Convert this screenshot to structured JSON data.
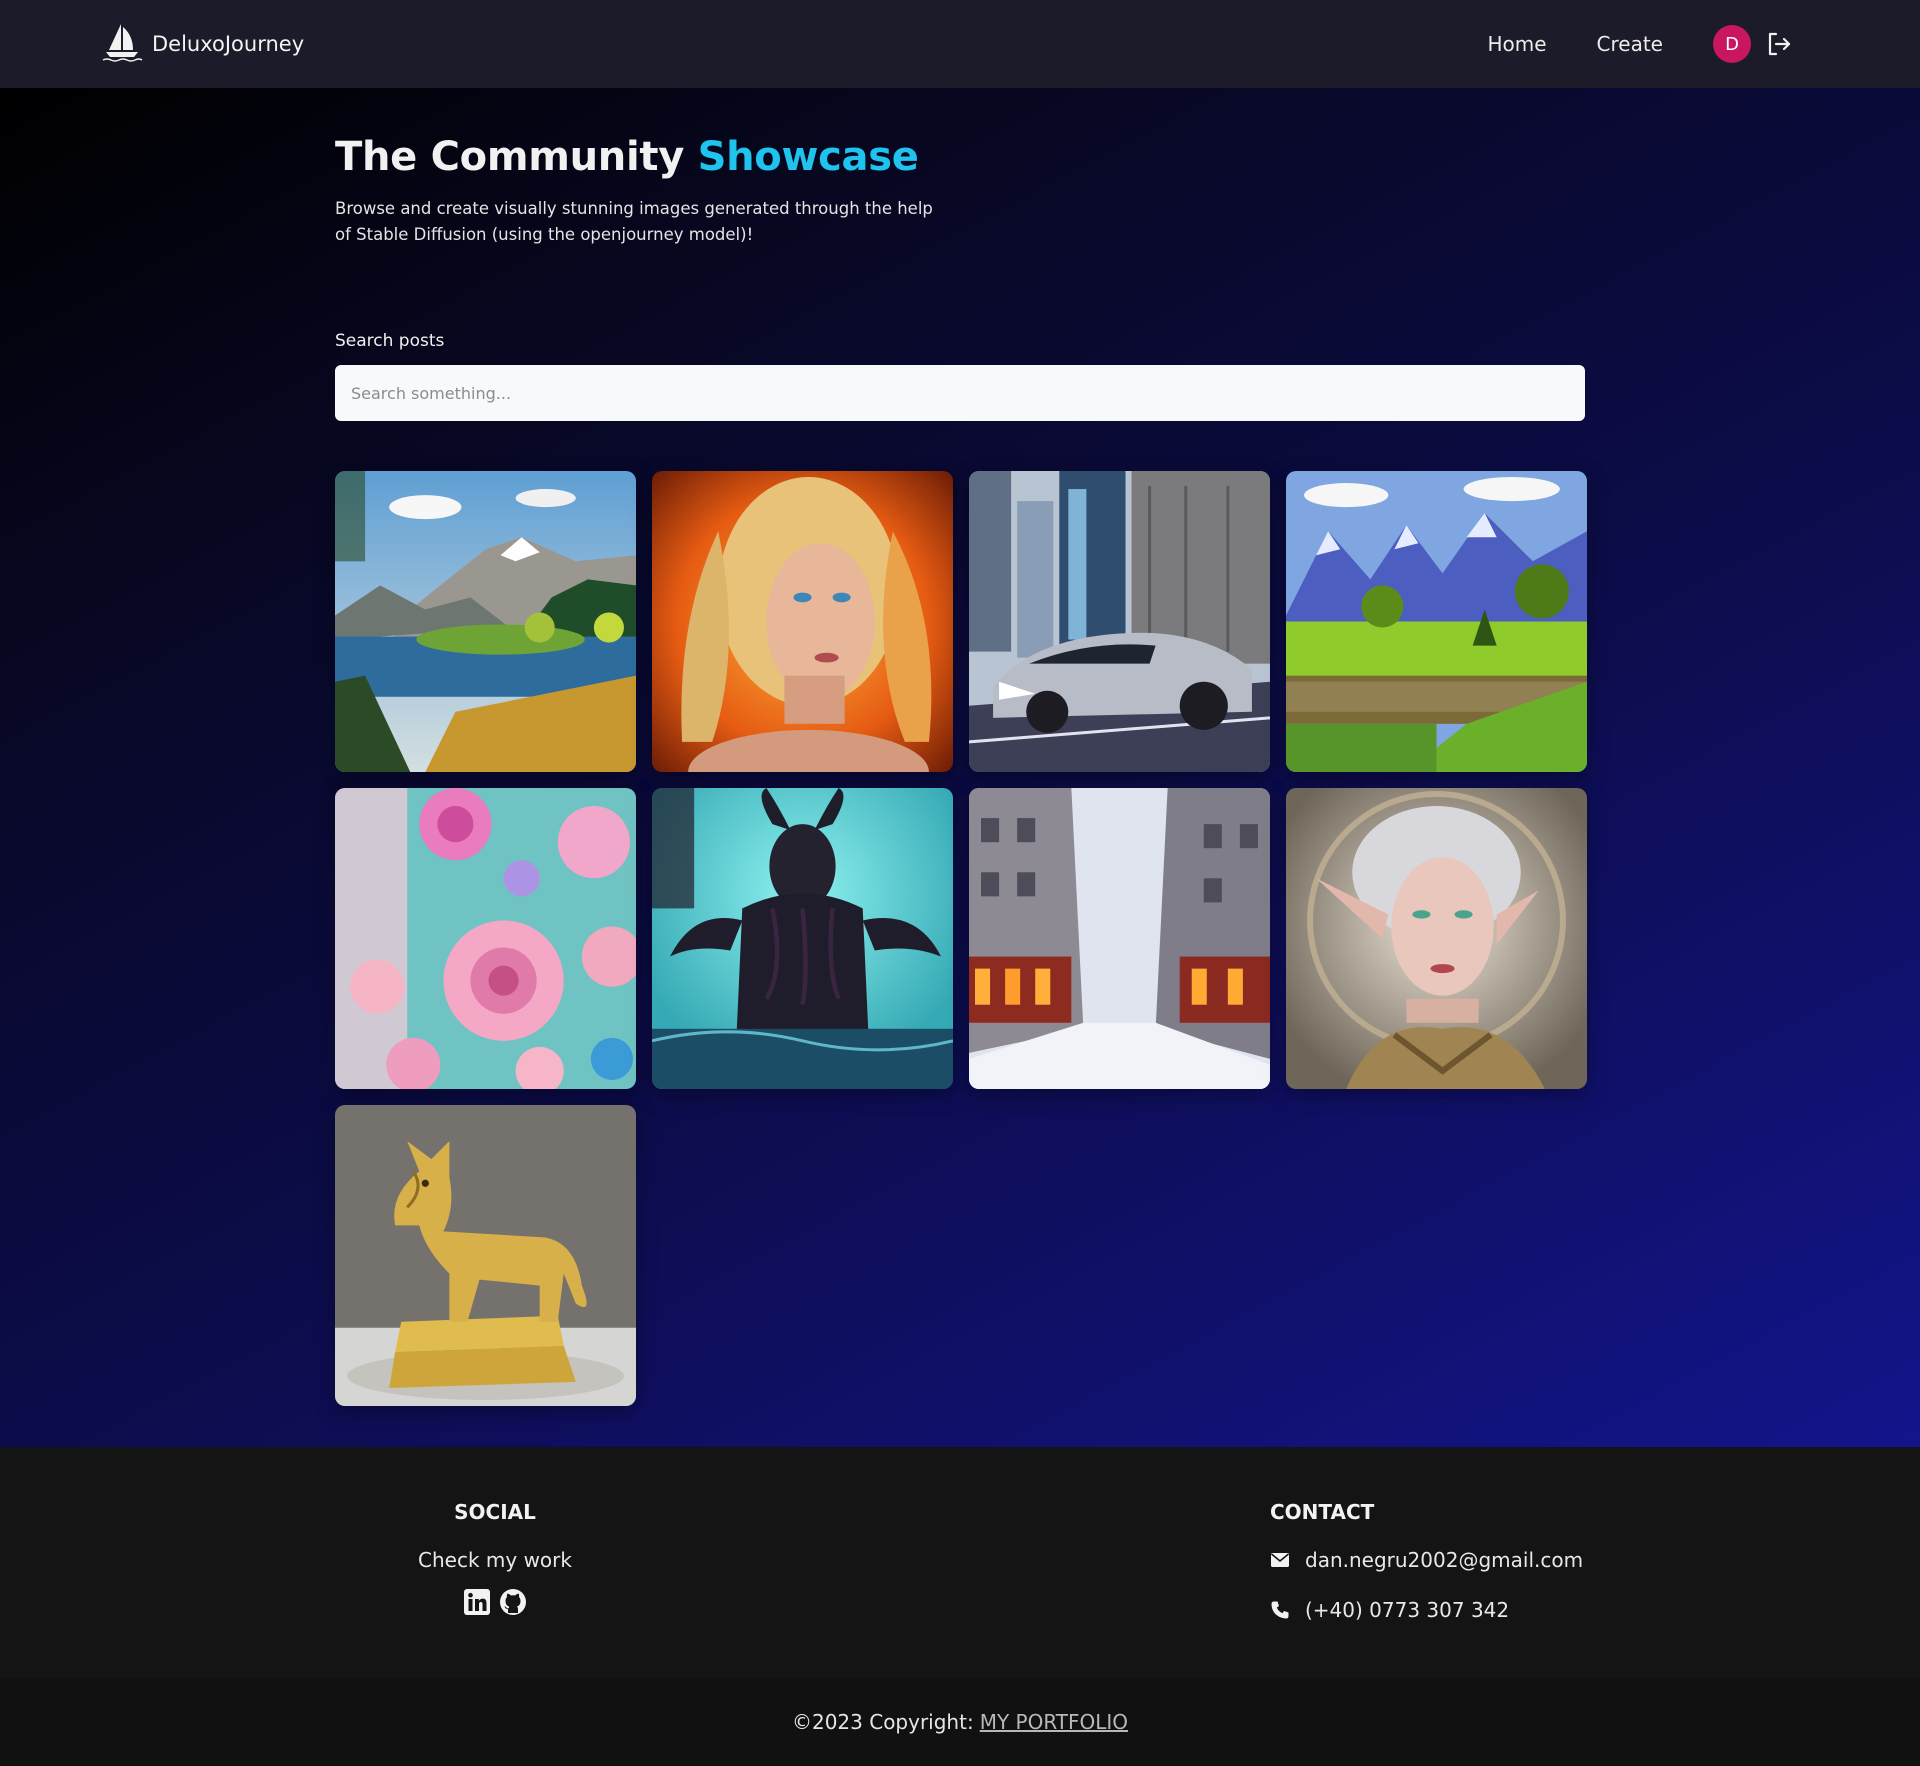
{
  "navbar": {
    "brand_name": "DeluxoJourney",
    "logo_icon": "sailboat-icon",
    "links": [
      "Home",
      "Create"
    ],
    "avatar_initial": "D",
    "avatar_color": "#c8175f",
    "logout_icon": "logout-icon"
  },
  "hero": {
    "title_main": "The Community",
    "title_accent": "Showcase",
    "accent_color": "#1ec3ee",
    "subtitle": "Browse and create visually stunning images generated through the help of Stable Diffusion (using the openjourney model)!"
  },
  "search": {
    "label": "Search posts",
    "placeholder": "Search something..."
  },
  "gallery": {
    "images": [
      "mountain-lake-landscape",
      "blonde-woman-fire-portrait",
      "silver-sports-car-city",
      "mountain-meadow-landscape",
      "pink-roses-fantasy",
      "horned-sea-monster",
      "snowy-city-street",
      "elf-woman-portrait",
      "golden-wolf-statue"
    ]
  },
  "footer": {
    "social_heading": "SOCIAL",
    "social_text": "Check my work",
    "social_icons": [
      "linkedin-icon",
      "github-icon"
    ],
    "contact_heading": "CONTACT",
    "email": "dan.negru2002@gmail.com",
    "phone": "(+40) 0773 307 342",
    "copyright_text": "©2023 Copyright:",
    "portfolio_link": "MY PORTFOLIO"
  }
}
